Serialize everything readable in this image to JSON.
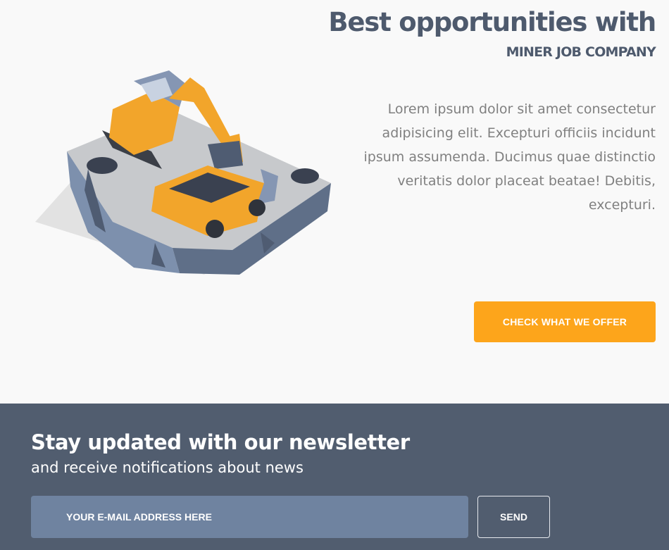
{
  "hero": {
    "title": "Best opportunities with",
    "subtitle": "MINER JOB COMPANY",
    "body": "Lorem ipsum dolor sit amet consectetur adipisicing elit. Excepturi officiis incidunt ipsum assumenda. Ducimus quae distinctio veritatis dolor placeat beatae! Debitis, excepturi.",
    "cta_label": "CHECK WHAT WE OFFER",
    "illustration_icon": "mining-excavator-truck-illustration"
  },
  "newsletter": {
    "title": "Stay updated with our newsletter",
    "subtitle": "and receive notifications about news",
    "email_placeholder": "YOUR E-MAIL ADDRESS HERE",
    "send_label": "SEND"
  },
  "colors": {
    "page_background": "#f9f9f9",
    "heading": "#4e5a6d",
    "body_text": "#808080",
    "accent": "#fda51b",
    "newsletter_background": "#515d6f",
    "input_background": "#6f83a0"
  }
}
